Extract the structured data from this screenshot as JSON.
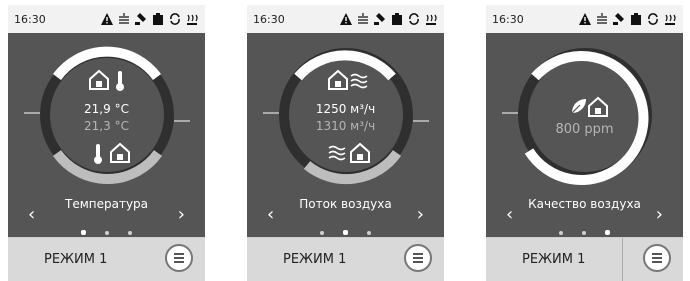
{
  "status_bar": {
    "time": "16:30",
    "icons": [
      "warning-icon",
      "heating-icon",
      "hand-icon",
      "filter-icon",
      "sync-icon",
      "heater-icon"
    ]
  },
  "screens": [
    {
      "title": "Температура",
      "main_value": "21,9 °C",
      "sub_value": "21,3 °C",
      "active_dot": 0,
      "mode_label": "РЕЖИМ 1"
    },
    {
      "title": "Поток воздуха",
      "main_value": "1250 м³/ч",
      "sub_value": "1310 м³/ч",
      "active_dot": 1,
      "mode_label": "РЕЖИМ 1"
    },
    {
      "title": "Качество воздуха",
      "main_value": "",
      "sub_value": "800 ppm",
      "active_dot": 2,
      "mode_label": "РЕЖИМ 1"
    }
  ],
  "nav": {
    "left_arrow": "‹",
    "right_arrow": "›"
  }
}
